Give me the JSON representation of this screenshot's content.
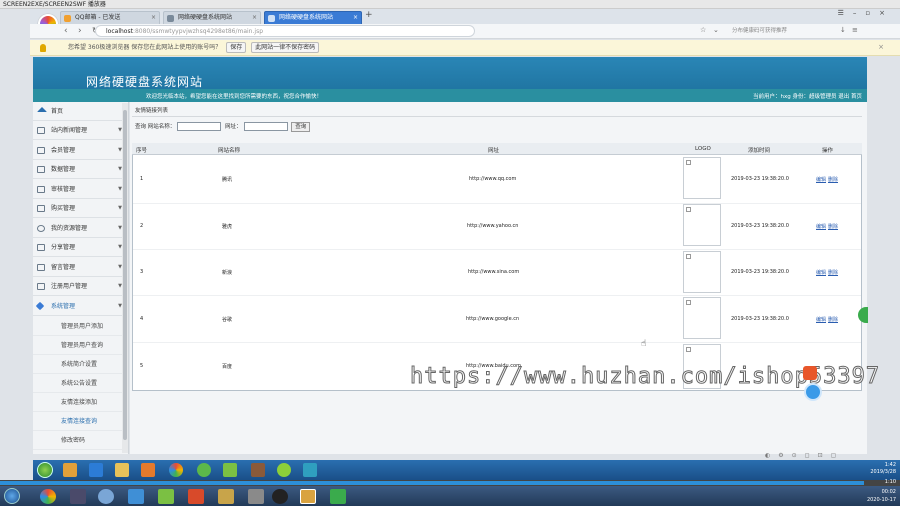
{
  "player": {
    "title": "SCREEN2EXE/SCREEN2SWF 播放器",
    "elapsed": "00:02",
    "total": "1:10"
  },
  "browser": {
    "tabs": [
      {
        "label": "QQ邮箱 - 已发送"
      },
      {
        "label": "网络硬硬盘系统网站"
      },
      {
        "label": "网络硬硬盘系统网站"
      }
    ],
    "url_host": "localhost",
    "url_rest": ":8080/ssmwtyypvjwzhsq4298et86/main.jsp",
    "search_placeholder": "分布健康码可获得推荐",
    "password_prompt": "您希望 360极速浏览器 保存您在此网站上使用的账号吗？",
    "password_save": "保存",
    "password_never": "此网站一律不保存密码"
  },
  "app": {
    "title": "网络硬硬盘系统网站",
    "welcome": "欢迎您光临本站，希望您能在这里找到您所需要的东西，祝您合作愉快！",
    "top_links": "当前用户：hxg 身份：超级管理员 退出 首页"
  },
  "sidebar": {
    "items": [
      {
        "label": "首页"
      },
      {
        "label": "站内新闻管理"
      },
      {
        "label": "会员管理"
      },
      {
        "label": "数据管理"
      },
      {
        "label": "审核管理"
      },
      {
        "label": "购买管理"
      },
      {
        "label": "我的资源管理"
      },
      {
        "label": "分享管理"
      },
      {
        "label": "留言管理"
      },
      {
        "label": "注册用户管理"
      },
      {
        "label": "系统管理"
      }
    ],
    "sub_items": [
      {
        "label": "管理员用户添加"
      },
      {
        "label": "管理员用户查询"
      },
      {
        "label": "系统简介设置"
      },
      {
        "label": "系统公告设置"
      },
      {
        "label": "友情连接添加"
      },
      {
        "label": "友情连接查询"
      },
      {
        "label": "修改密码"
      }
    ]
  },
  "main": {
    "breadcrumb": "友情链接列表",
    "search_label": "查询 网站名称：",
    "search_label2": "网址：",
    "search_button": "查询",
    "columns": [
      "序号",
      "网站名称",
      "网址",
      "LOGO",
      "添加时间",
      "操作"
    ],
    "rows": [
      {
        "no": "1",
        "name": "腾讯",
        "url": "http://www.qq.com",
        "time": "2019-03-23 19:38:20.0"
      },
      {
        "no": "2",
        "name": "雅虎",
        "url": "http://www.yahoo.cn",
        "time": "2019-03-23 19:38:20.0"
      },
      {
        "no": "3",
        "name": "新浪",
        "url": "http://www.sina.com",
        "time": "2019-03-23 19:38:20.0"
      },
      {
        "no": "4",
        "name": "谷歌",
        "url": "http://www.google.cn",
        "time": "2019-03-23 19:38:20.0"
      },
      {
        "no": "5",
        "name": "百度",
        "url": "http://www.baidu.com",
        "time": ""
      }
    ],
    "edit_label": "编辑",
    "delete_label": "删除"
  },
  "watermark": "https://www.huzhan.com/ishop53397",
  "taskbar_inner": {
    "time": "1:42",
    "date": "2019/3/28"
  },
  "taskbar_outer": {
    "time": "00:02",
    "date": "2020-10-17"
  }
}
